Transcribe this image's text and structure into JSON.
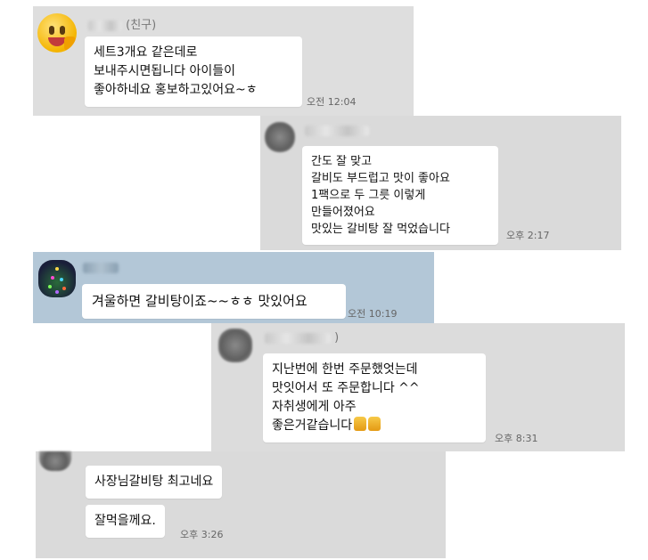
{
  "chats": [
    {
      "sender_suffix": "(친구)",
      "avatar_icon": "thumbs-up-face-icon",
      "message": "세트3개요 같은데로\n보내주시면됩니다 아이들이\n좋아하네요 홍보하고있어요~ㅎ",
      "time": "오전 12:04"
    },
    {
      "avatar_icon": "blurred-avatar",
      "message": "간도 잘 맞고\n갈비도 부드럽고 맛이 좋아요\n1팩으로 두 그릇 이렇게\n만들어졌어요\n맛있는 갈비탕 잘 먹었습니다",
      "time": "오후 2:17"
    },
    {
      "avatar_icon": "christmas-tree-avatar",
      "message": "겨울하면 갈비탕이죠~~ㅎㅎ 맛있어요",
      "time": "오전 10:19"
    },
    {
      "sender_suffix": ")",
      "avatar_icon": "blurred-avatar",
      "message": "지난번에 한번 주문했엇는데\n맛잇어서 또 주문합니다 ^^\n자취생에게 아주\n좋은거같습니다",
      "emoji": "thumbs-up-emoji",
      "time": "오후 8:31"
    },
    {
      "avatar_icon": "blurred-avatar",
      "messages": [
        "사장님갈비탕 최고네요",
        "잘먹을께요."
      ],
      "time": "오후 3:26"
    }
  ]
}
